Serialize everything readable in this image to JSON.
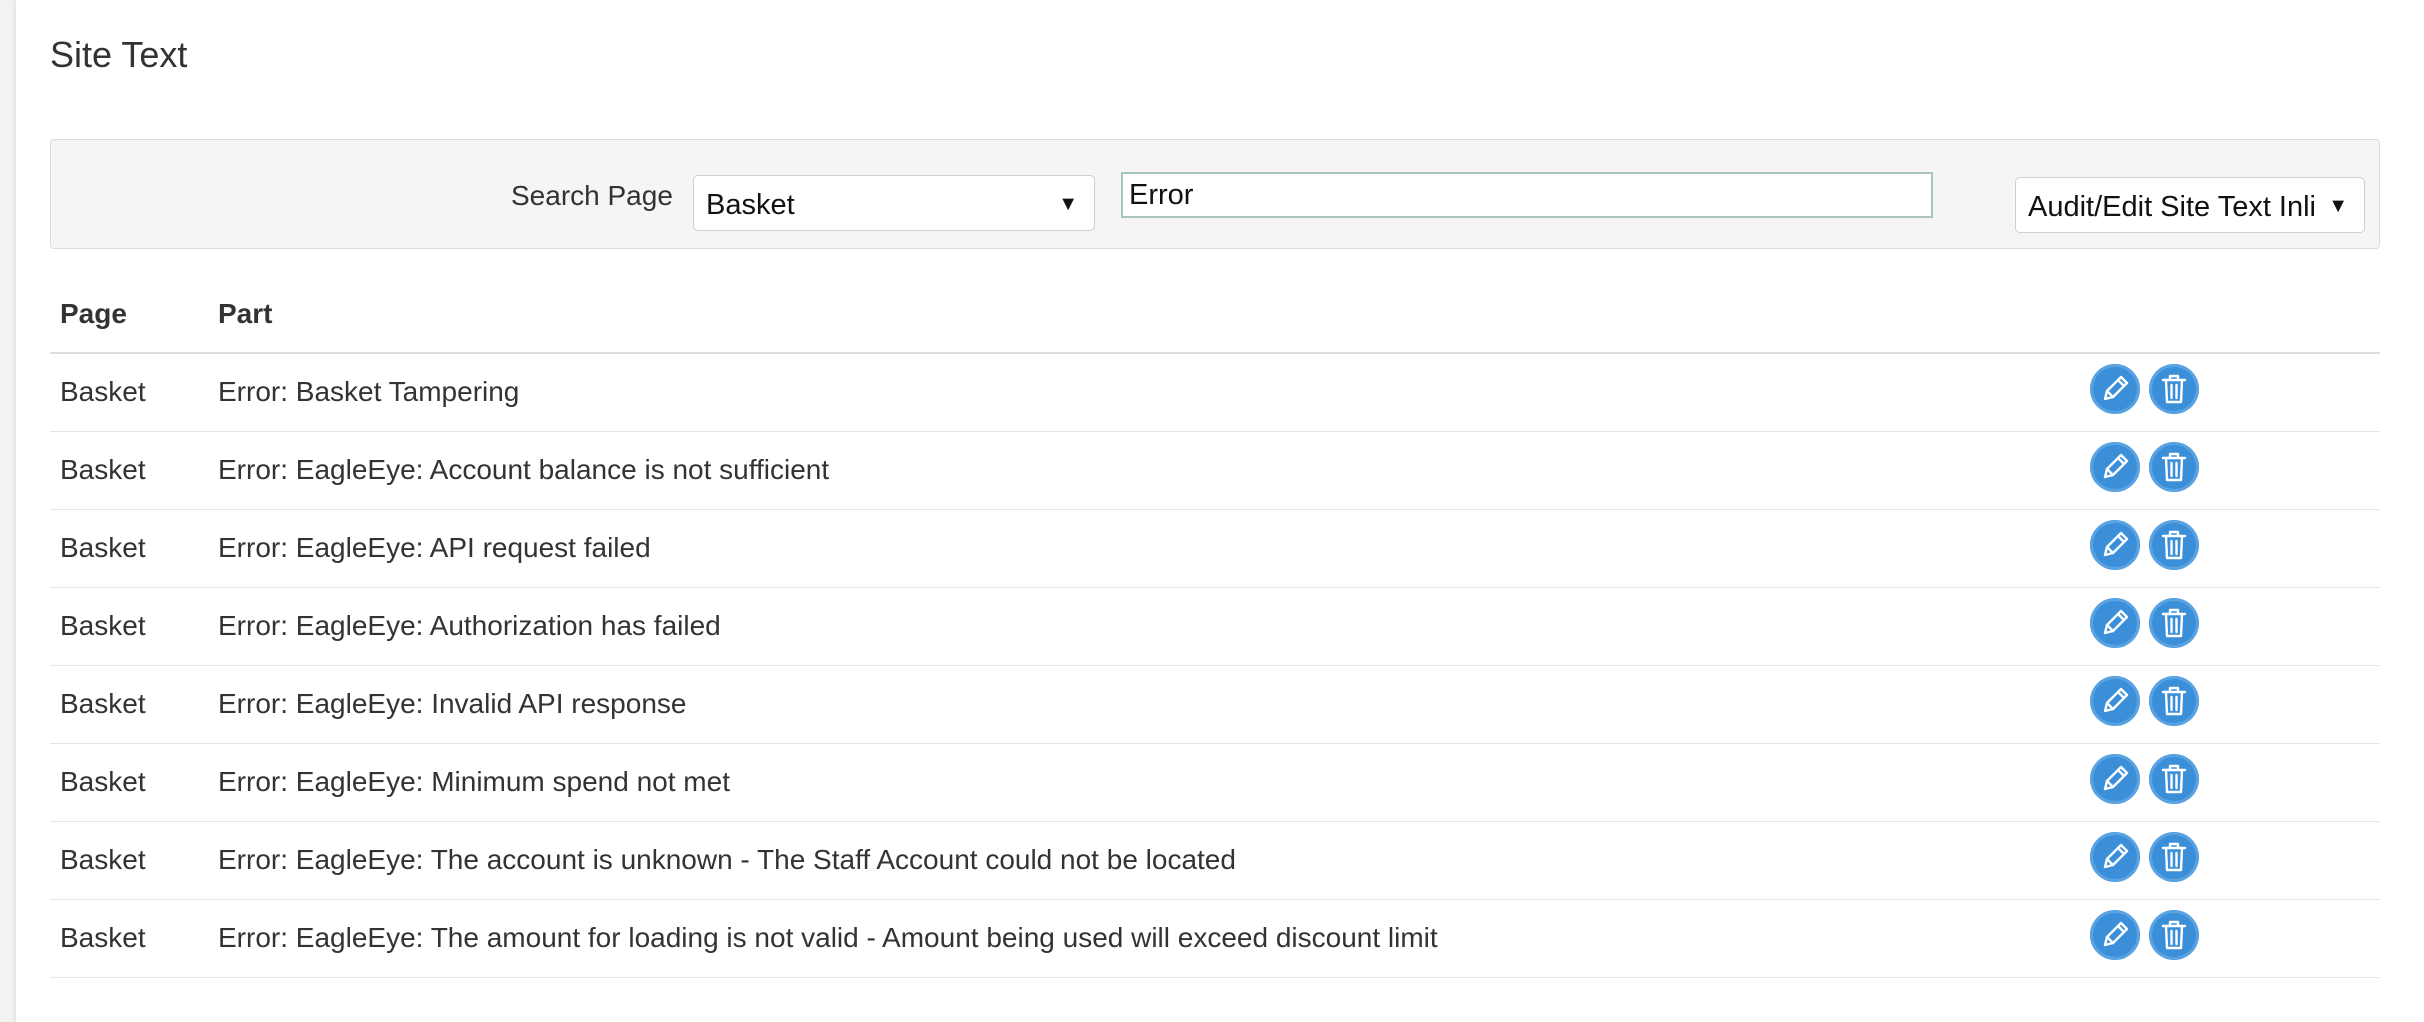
{
  "page": {
    "title": "Site Text"
  },
  "search": {
    "label": "Search Page",
    "page_select_value": "Basket",
    "query_value": "Error",
    "action_select_value": "Audit/Edit Site Text Inline"
  },
  "table": {
    "headers": {
      "page": "Page",
      "part": "Part"
    },
    "rows": [
      {
        "page": "Basket",
        "part": "Error: Basket Tampering"
      },
      {
        "page": "Basket",
        "part": "Error: EagleEye: Account balance is not sufficient"
      },
      {
        "page": "Basket",
        "part": "Error: EagleEye: API request failed"
      },
      {
        "page": "Basket",
        "part": "Error: EagleEye: Authorization has failed"
      },
      {
        "page": "Basket",
        "part": "Error: EagleEye: Invalid API response"
      },
      {
        "page": "Basket",
        "part": "Error: EagleEye: Minimum spend not met"
      },
      {
        "page": "Basket",
        "part": "Error: EagleEye: The account is unknown - The Staff Account could not be located"
      },
      {
        "page": "Basket",
        "part": "Error: EagleEye: The amount for loading is not valid - Amount being used will exceed discount limit"
      }
    ]
  },
  "icons": {
    "edit": "pencil-icon",
    "delete": "trash-icon",
    "dropdown": "caret-down-icon"
  },
  "colors": {
    "action_button": "#3b8fd9"
  }
}
